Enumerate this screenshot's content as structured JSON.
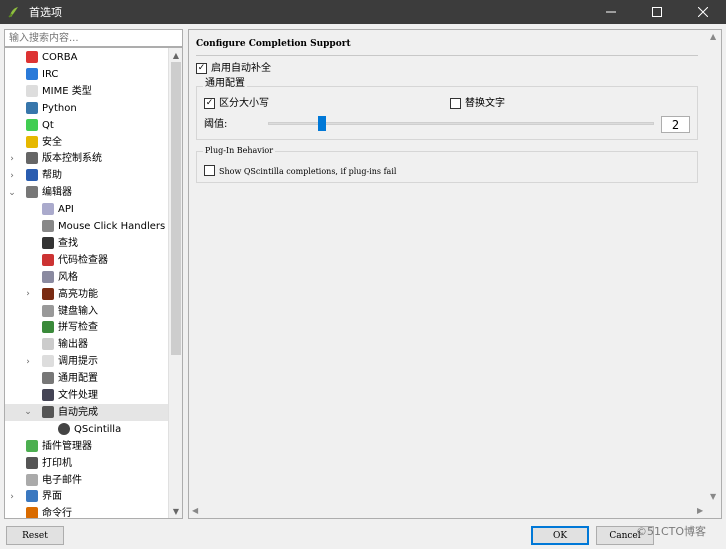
{
  "window": {
    "title": "首选项"
  },
  "search": {
    "placeholder": "输入搜索内容..."
  },
  "tree": [
    {
      "label": "CORBA",
      "icon": "corba-icon"
    },
    {
      "label": "IRC",
      "icon": "irc-icon"
    },
    {
      "label": "MIME 类型",
      "icon": "mime-icon"
    },
    {
      "label": "Python",
      "icon": "python-icon"
    },
    {
      "label": "Qt",
      "icon": "qt-icon"
    },
    {
      "label": "安全",
      "icon": "lock-icon"
    },
    {
      "label": "版本控制系统",
      "icon": "vcs-icon"
    },
    {
      "label": "帮助",
      "icon": "help-icon"
    },
    {
      "label": "编辑器",
      "icon": "editor-icon"
    },
    {
      "label": "API",
      "icon": "api-icon"
    },
    {
      "label": "Mouse Click Handlers",
      "icon": "mouse-icon"
    },
    {
      "label": "查找",
      "icon": "binoculars-icon"
    },
    {
      "label": "代码检查器",
      "icon": "bug-icon"
    },
    {
      "label": "风格",
      "icon": "style-icon"
    },
    {
      "label": "高亮功能",
      "icon": "highlight-icon"
    },
    {
      "label": "键盘输入",
      "icon": "keyboard-icon"
    },
    {
      "label": "拼写检查",
      "icon": "spellcheck-icon"
    },
    {
      "label": "输出器",
      "icon": "export-icon"
    },
    {
      "label": "调用提示",
      "icon": "calltip-icon"
    },
    {
      "label": "通用配置",
      "icon": "wrench-icon"
    },
    {
      "label": "文件处理",
      "icon": "save-icon"
    },
    {
      "label": "自动完成",
      "icon": "autocomplete-icon"
    },
    {
      "label": "QScintilla",
      "icon": "qscintilla-icon"
    },
    {
      "label": "插件管理器",
      "icon": "plugin-icon"
    },
    {
      "label": "打印机",
      "icon": "printer-icon"
    },
    {
      "label": "电子邮件",
      "icon": "mail-icon"
    },
    {
      "label": "界面",
      "icon": "monitor-icon"
    },
    {
      "label": "命令行",
      "icon": "terminal-icon"
    }
  ],
  "config": {
    "title": "Configure Completion Support",
    "enable_label": "启用自动补全",
    "general_group": "通用配置",
    "case_sensitive": "区分大小写",
    "replace_word": "替换文字",
    "threshold_label": "阈值:",
    "threshold_value": "2",
    "threshold_fraction": 0.14,
    "plugin_group": "Plug-In Behavior",
    "plugin_option": "Show QScintilla completions, if plug-ins fail"
  },
  "buttons": {
    "reset": "Reset",
    "ok": "OK",
    "cancel": "Cancel"
  },
  "watermark": "©51CTO博客"
}
